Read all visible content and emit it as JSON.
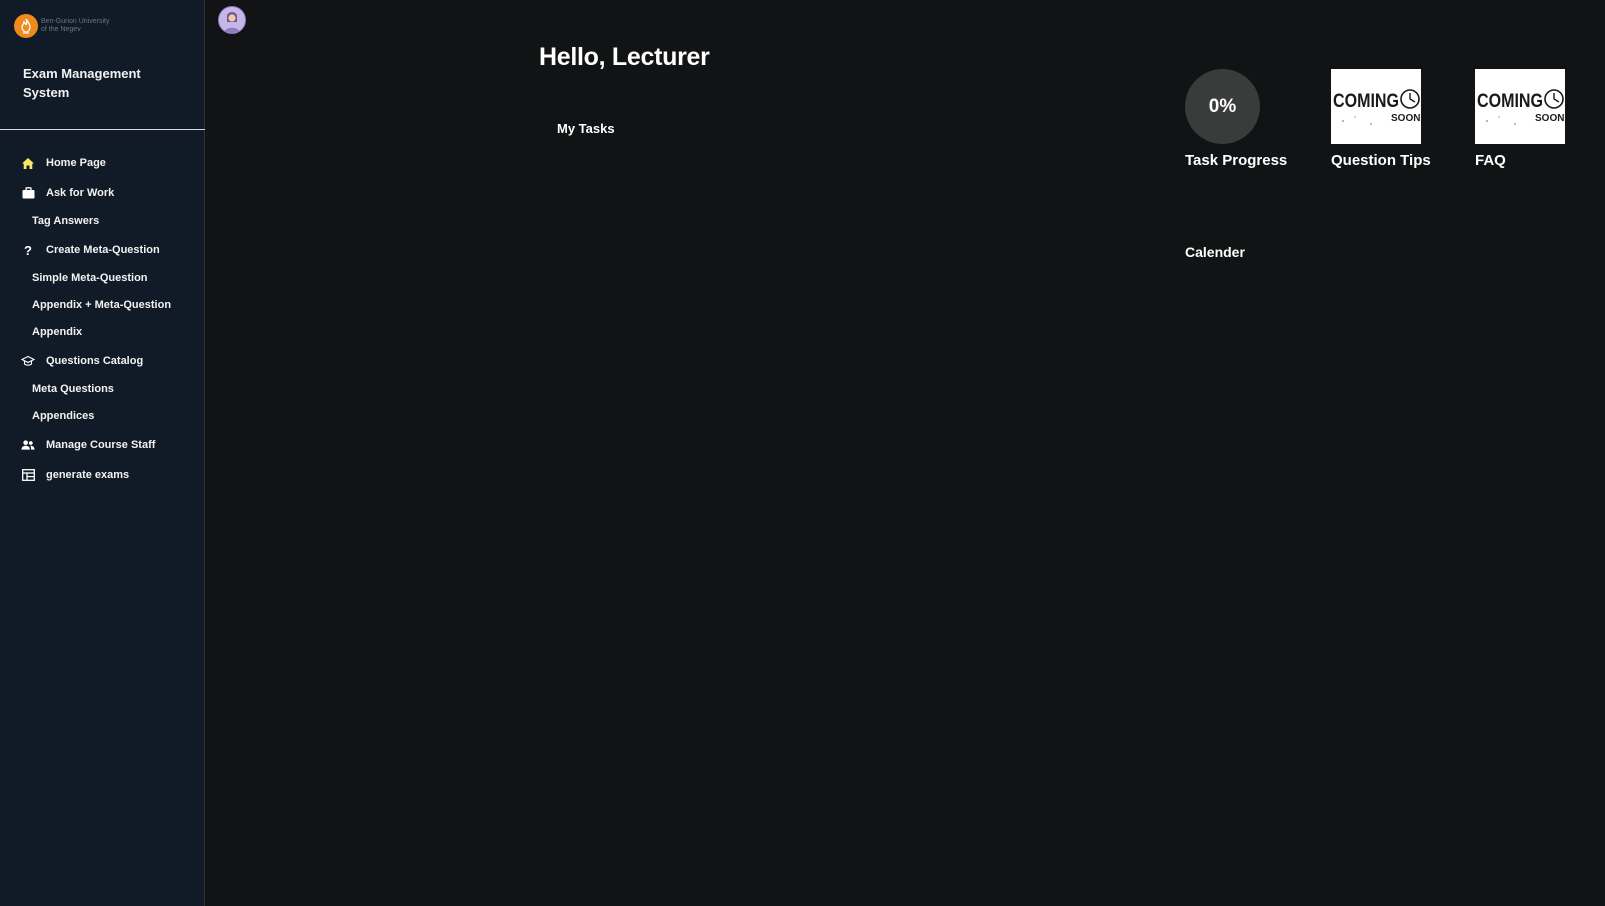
{
  "sidebar": {
    "logo": {
      "line1": "Ben-Gurion University",
      "line2": "of the Negev",
      "icon": "flame-logo-icon"
    },
    "app_title": "Exam Management System",
    "items": [
      {
        "label": "Home Page",
        "icon": "home-icon",
        "type": "main"
      },
      {
        "label": "Ask for Work",
        "icon": "briefcase-icon",
        "type": "main"
      },
      {
        "label": "Tag Answers",
        "type": "sub"
      },
      {
        "label": "Create Meta-Question",
        "icon": "question-mark-icon",
        "type": "main"
      },
      {
        "label": "Simple Meta-Question",
        "type": "sub"
      },
      {
        "label": "Appendix + Meta-Question",
        "type": "sub"
      },
      {
        "label": "Appendix",
        "type": "sub"
      },
      {
        "label": "Questions Catalog",
        "icon": "graduation-cap-icon",
        "type": "main"
      },
      {
        "label": "Meta Questions",
        "type": "sub"
      },
      {
        "label": "Appendices",
        "type": "sub"
      },
      {
        "label": "Manage Course Staff",
        "icon": "people-icon",
        "type": "main"
      },
      {
        "label": "generate exams",
        "icon": "table-icon",
        "type": "main"
      }
    ],
    "active_icon_color": "#f5e96a"
  },
  "header": {
    "avatar_icon": "user-avatar-icon"
  },
  "main": {
    "greeting": "Hello, Lecturer",
    "tasks_title": "My Tasks"
  },
  "widgets": {
    "progress": {
      "value_text": "0%",
      "value": 0,
      "label": "Task Progress"
    },
    "question_tips": {
      "label": "Question Tips",
      "image_text_1": "COMING",
      "image_text_2": "SOON"
    },
    "faq": {
      "label": "FAQ",
      "image_text_1": "COMING",
      "image_text_2": "SOON"
    },
    "calendar_title": "Calender"
  }
}
